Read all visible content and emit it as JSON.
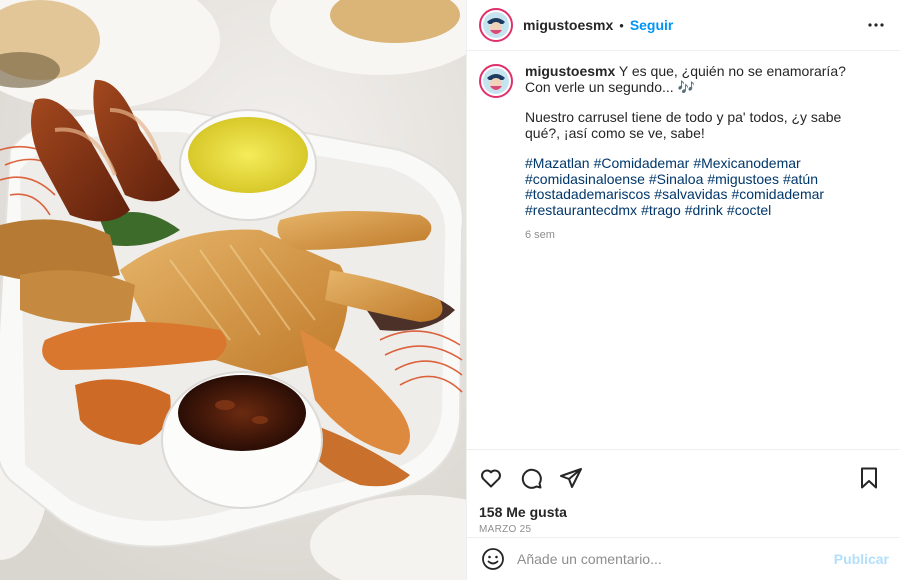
{
  "post": {
    "username": "migustoesmx",
    "follow_label": "Seguir",
    "separator": "•",
    "caption": {
      "username": "migustoesmx",
      "line1": "Y es que, ¿quién no se enamoraría? Con verle un segundo... 🎶",
      "line2": "Nuestro carrusel tiene de todo y pa' todos, ¿y sabe qué?, ¡así como se ve, sabe!",
      "hashtags": [
        "#Mazatlan",
        "#Comidademar",
        "#Mexicanodemar",
        "#comidasinaloense",
        "#Sinaloa",
        "#migustoes",
        "#atún",
        "#tostadademariscos",
        "#salvavidas",
        "#comidademar",
        "#restaurantecdmx",
        "#trago",
        "#drink",
        "#coctel"
      ],
      "time_ago": "6 sem"
    },
    "likes": "158 Me gusta",
    "date": "MARZO 25",
    "comment_placeholder": "Añade un comentario...",
    "publish_label": "Publicar"
  },
  "icons": {
    "avatar": "avatar-logo-icon",
    "more": "more-options-icon",
    "like": "heart-icon",
    "comment": "comment-icon",
    "share": "share-icon",
    "save": "bookmark-icon",
    "emoji": "emoji-icon"
  },
  "colors": {
    "link_blue": "#0095f6",
    "hashtag": "#00376b",
    "muted": "#8e8e8e",
    "publish_disabled": "#b2dffc",
    "avatar_ring": "#e0306a"
  }
}
